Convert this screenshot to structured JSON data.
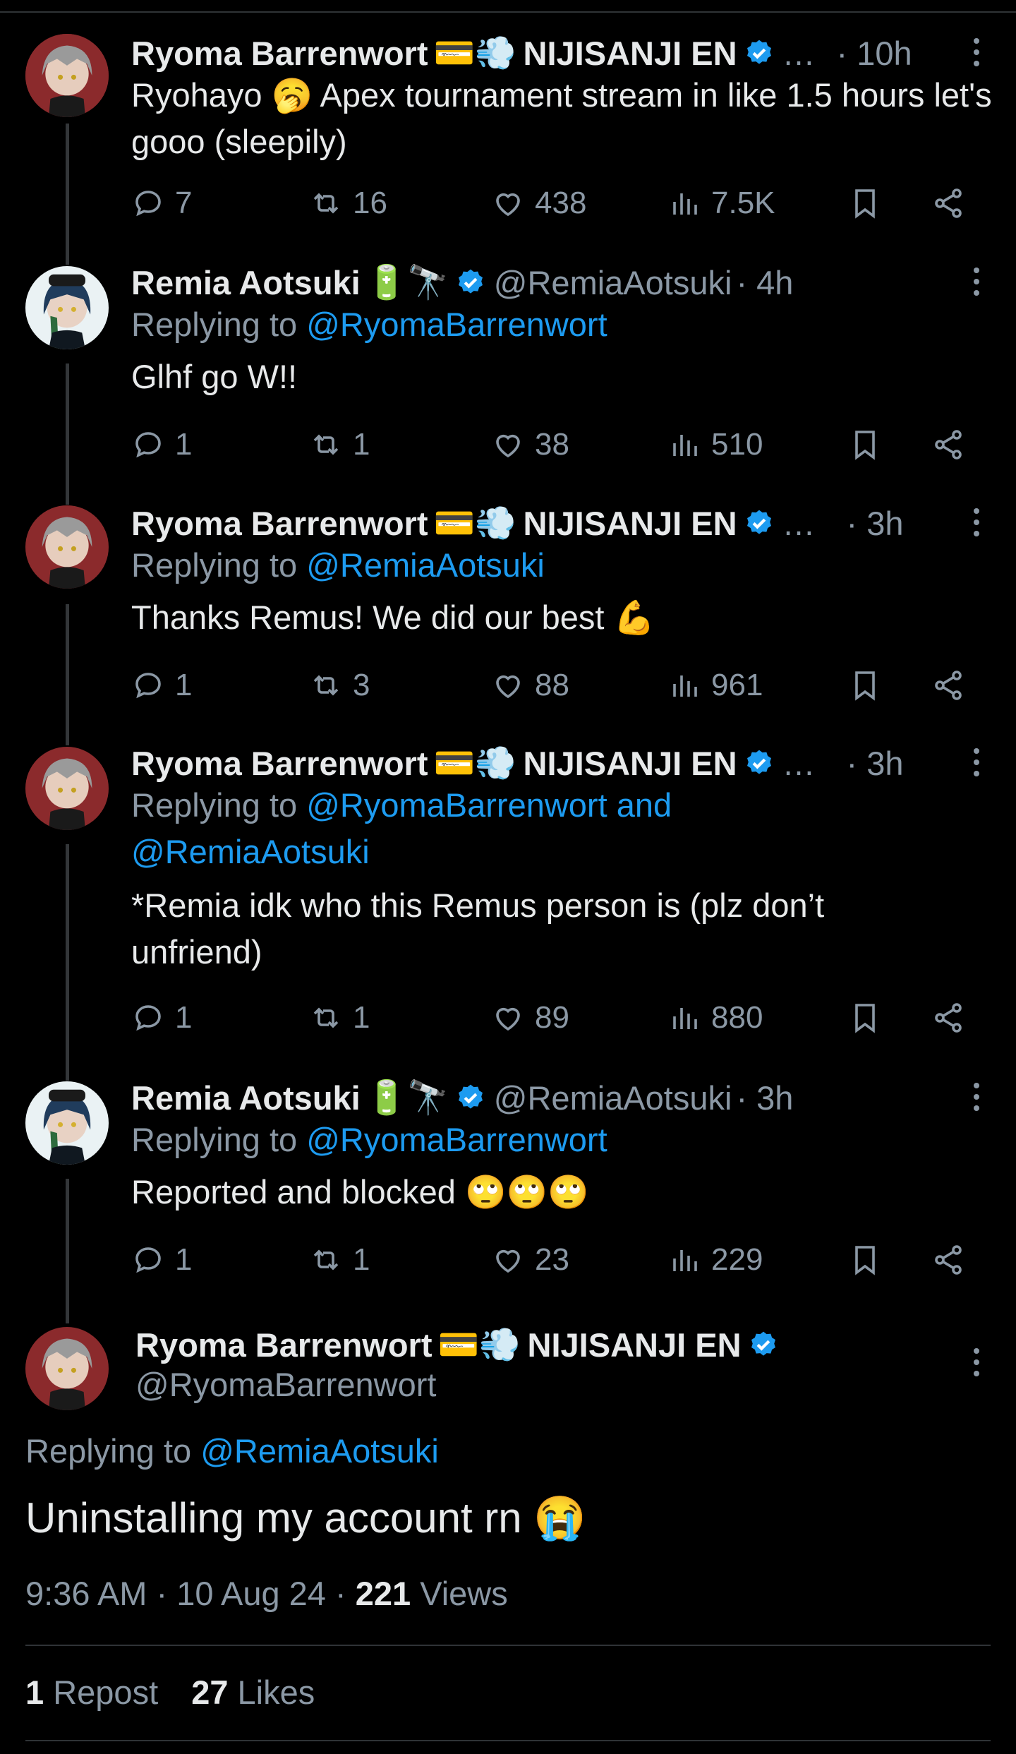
{
  "tweets": [
    {
      "name": "Ryoma Barrenwort",
      "emojis": "💳💨",
      "affiliation": "NIJISANJI EN",
      "handle": "…",
      "time": "· 10h",
      "replying_prefix": "",
      "replying_to": "",
      "text": "Ryohayo 🥱 Apex tournament stream in like 1.5 hours let's gooo (sleepily)",
      "replies": "7",
      "reposts": "16",
      "likes": "438",
      "views": "7.5K"
    },
    {
      "name": "Remia Aotsuki",
      "emojis": "🔋🔭",
      "affiliation": "",
      "handle": "@RemiaAotsuki",
      "time": "· 4h",
      "replying_prefix": "Replying to",
      "replying_to": "@RyomaBarrenwort",
      "text": "Glhf go W!!",
      "replies": "1",
      "reposts": "1",
      "likes": "38",
      "views": "510"
    },
    {
      "name": "Ryoma Barrenwort",
      "emojis": "💳💨",
      "affiliation": "NIJISANJI EN",
      "handle": "…",
      "time": "· 3h",
      "replying_prefix": "Replying to",
      "replying_to": "@RemiaAotsuki",
      "text": "Thanks Remus! We did our best 💪",
      "replies": "1",
      "reposts": "3",
      "likes": "88",
      "views": "961"
    },
    {
      "name": "Ryoma Barrenwort",
      "emojis": "💳💨",
      "affiliation": "NIJISANJI EN",
      "handle": "…",
      "time": "· 3h",
      "replying_prefix": "Replying to",
      "replying_to": "@RyomaBarrenwort and @RemiaAotsuki",
      "text": "*Remia idk who this Remus person is (plz don’t unfriend)",
      "replies": "1",
      "reposts": "1",
      "likes": "89",
      "views": "880"
    },
    {
      "name": "Remia Aotsuki",
      "emojis": "🔋🔭",
      "affiliation": "",
      "handle": "@RemiaAotsuki",
      "time": "· 3h",
      "replying_prefix": "Replying to",
      "replying_to": "@RyomaBarrenwort",
      "text": "Reported and blocked 🙄🙄🙄",
      "replies": "1",
      "reposts": "1",
      "likes": "23",
      "views": "229"
    }
  ],
  "focused": {
    "name": "Ryoma Barrenwort",
    "emojis": "💳💨",
    "affiliation": "NIJISANJI EN",
    "handle": "@RyomaBarrenwort",
    "replying_prefix": "Replying to",
    "replying_to": "@RemiaAotsuki",
    "text": "Uninstalling my account rn 😭",
    "time": "9:36 AM",
    "date": "10 Aug 24",
    "views_count": "221",
    "views_label": "Views",
    "reposts_count": "1",
    "reposts_label": "Repost",
    "likes_count": "27",
    "likes_label": "Likes"
  },
  "colors": {
    "accent": "#1d9bf0",
    "muted": "#8b98a5",
    "text": "#e7e9ea",
    "bg": "#000000"
  }
}
